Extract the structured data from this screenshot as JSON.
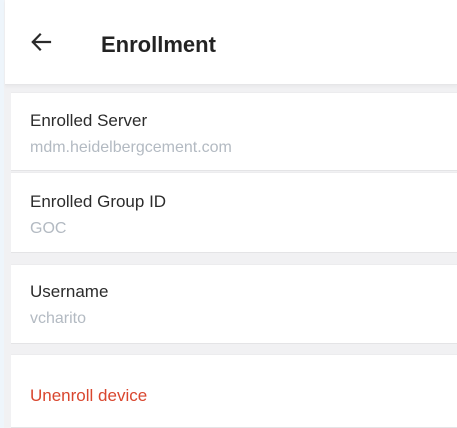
{
  "header": {
    "title": "Enrollment",
    "back_icon": "arrow-left-icon"
  },
  "details": {
    "server": {
      "label": "Enrolled Server",
      "value": "mdm.heidelbergcement.com"
    },
    "group": {
      "label": "Enrolled Group ID",
      "value": "GOC"
    },
    "username": {
      "label": "Username",
      "value": "vcharito"
    }
  },
  "actions": {
    "unenroll_label": "Unenroll device"
  },
  "colors": {
    "background": "#f1f1f3",
    "card": "#ffffff",
    "label_text": "#2b2b2b",
    "value_text": "#b3bac2",
    "danger": "#d9462e"
  }
}
